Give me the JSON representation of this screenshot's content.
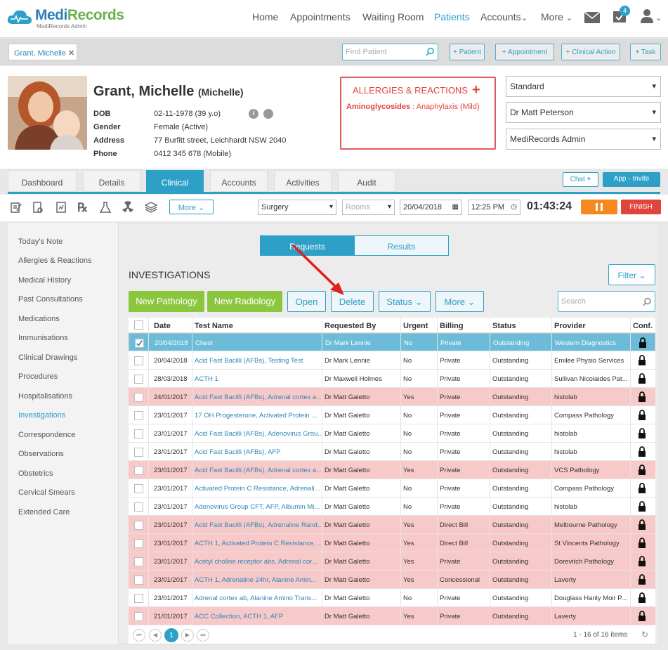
{
  "brand": {
    "name_a": "Medi",
    "name_b": "Records",
    "sub": "MediRecords Admin"
  },
  "nav": {
    "items": [
      "Home",
      "Appointments",
      "Waiting Room",
      "Patients",
      "Accounts",
      "More"
    ],
    "badge": "4"
  },
  "subbar": {
    "patient_chip": "Grant, Michelle",
    "find_placeholder": "Find Patient",
    "buttons": [
      "+ Patient",
      "+ Appointment",
      "+ Clinical Action",
      "+ Task"
    ]
  },
  "patient": {
    "name": "Grant, Michelle",
    "nick": "(Michelle)",
    "labels": [
      "DOB",
      "Gender",
      "Address",
      "Phone"
    ],
    "values": [
      "02-11-1978 (39 y.o)",
      "Female (Active)",
      "77 Burfitt street, Leichhardt NSW 2040",
      "0412 345 678 (Mobile)"
    ]
  },
  "allergies": {
    "title": "ALLERGIES & REACTIONS",
    "items": [
      {
        "drug": "Aminoglycosides",
        "reaction": " : Anaphylaxis (Mild)"
      }
    ]
  },
  "selects": [
    "Standard",
    "Dr Matt Peterson",
    "MediRecords Admin"
  ],
  "tabs": [
    "Dashboard",
    "Details",
    "Clinical",
    "Accounts",
    "Activities",
    "Audit"
  ],
  "tab_buttons": {
    "chat": "Chat",
    "invite": "App - Invite"
  },
  "toolbar": {
    "more": "More",
    "location": "Surgery",
    "rooms": "Rooms",
    "date": "20/04/2018",
    "time": "12:25 PM",
    "timer": "01:43:24",
    "finish": "FINISH"
  },
  "sidenav": [
    "Today's Note",
    "Allergies & Reactions",
    "Medical History",
    "Past Consultations",
    "Medications",
    "Immunisations",
    "Clinical Drawings",
    "Procedures",
    "Hospitalisations",
    "Investigations",
    "Correspondence",
    "Observations",
    "Obstetrics",
    "Cervical Smears",
    "Extended Care"
  ],
  "segments": [
    "Requests",
    "Results"
  ],
  "investigations": {
    "title": "INVESTIGATIONS",
    "filter": "Filter",
    "new_pathology": "New Pathology",
    "new_radiology": "New Radiology",
    "open": "Open",
    "delete": "Delete",
    "status": "Status",
    "more": "More",
    "search_placeholder": "Search"
  },
  "table": {
    "columns": [
      "Date",
      "Test Name",
      "Requested By",
      "Urgent",
      "Billing",
      "Status",
      "Provider",
      "Conf."
    ],
    "rows": [
      [
        "20/04/2018",
        "Chest",
        "Dr Mark Lennie",
        "No",
        "Private",
        "Outstanding",
        "Western Diagnostics"
      ],
      [
        "20/04/2018",
        "Acid Fast Bacilli (AFBs), Testing Test",
        "Dr Mark Lennie",
        "No",
        "Private",
        "Outstanding",
        "Emilee Physio Services"
      ],
      [
        "28/03/2018",
        "ACTH 1",
        "Dr Maxwell Holmes",
        "No",
        "Private",
        "Outstanding",
        "Sullivan Nicolaides Pat..."
      ],
      [
        "24/01/2017",
        "Acid Fast Bacilli (AFBs), Adrenal cortex a...",
        "Dr Matt Galetto",
        "Yes",
        "Private",
        "Outstanding",
        "histolab"
      ],
      [
        "23/01/2017",
        "17 OH Progesterone, Activated Protein ...",
        "Dr Matt Galetto",
        "No",
        "Private",
        "Outstanding",
        "Compass Pathology"
      ],
      [
        "23/01/2017",
        "Acid Fast Bacilli (AFBs), Adenovirus Grou...",
        "Dr Matt Galetto",
        "No",
        "Private",
        "Outstanding",
        "histolab"
      ],
      [
        "23/01/2017",
        "Acid Fast Bacilli (AFBs), AFP",
        "Dr Matt Galetto",
        "No",
        "Private",
        "Outstanding",
        "histolab"
      ],
      [
        "23/01/2017",
        "Acid Fast Bacilli (AFBs), Adrenal cortex a...",
        "Dr Matt Galetto",
        "Yes",
        "Private",
        "Outstanding",
        "VCS Pathology"
      ],
      [
        "23/01/2017",
        "Activated Protein C Resistance, Adrenali...",
        "Dr Matt Galetto",
        "No",
        "Private",
        "Outstanding",
        "Compass Pathology"
      ],
      [
        "23/01/2017",
        "Adenovirus Group CFT, AFP, Albumin Mi...",
        "Dr Matt Galetto",
        "No",
        "Private",
        "Outstanding",
        "histolab"
      ],
      [
        "23/01/2017",
        "Acid Fast Bacilli (AFBs), Adrenaline Rand...",
        "Dr Matt Galetto",
        "Yes",
        "Direct Bill",
        "Outstanding",
        "Melbourne Pathology"
      ],
      [
        "23/01/2017",
        "ACTH 1, Activated Protein C Resistance, ...",
        "Dr Matt Galetto",
        "Yes",
        "Direct Bill",
        "Outstanding",
        "St Vincents Pathology"
      ],
      [
        "23/01/2017",
        "Acetyl choline receptor abs, Adrenal cor...",
        "Dr Matt Galetto",
        "Yes",
        "Private",
        "Outstanding",
        "Dorevitch Pathology"
      ],
      [
        "23/01/2017",
        "ACTH 1, Adrenaline 24hr, Alanine Amin...",
        "Dr Matt Galetto",
        "Yes",
        "Concessional",
        "Outstanding",
        "Laverty"
      ],
      [
        "23/01/2017",
        "Adrenal cortex ab, Alanine Amino Trans...",
        "Dr Matt Galetto",
        "No",
        "Private",
        "Outstanding",
        "Douglass Hanly Moir P..."
      ],
      [
        "21/01/2017",
        "ACC Collection, ACTH 1, AFP",
        "Dr Matt Galetto",
        "Yes",
        "Private",
        "Outstanding",
        "Laverty"
      ]
    ],
    "row_styles": [
      "sel",
      "white",
      "white",
      "pink",
      "white",
      "white",
      "white",
      "pink",
      "white",
      "white",
      "pink",
      "pink",
      "pink",
      "pink",
      "white",
      "pink"
    ]
  },
  "pager": {
    "page": "1",
    "info": "1 - 16 of 16 items"
  },
  "colors": {
    "accent": "#2ea0c7",
    "green": "#8cc63e",
    "pink_row": "#f8c9c9",
    "selected_row": "#6cbcd9",
    "danger": "#e0443e",
    "warn": "#f5891f"
  }
}
